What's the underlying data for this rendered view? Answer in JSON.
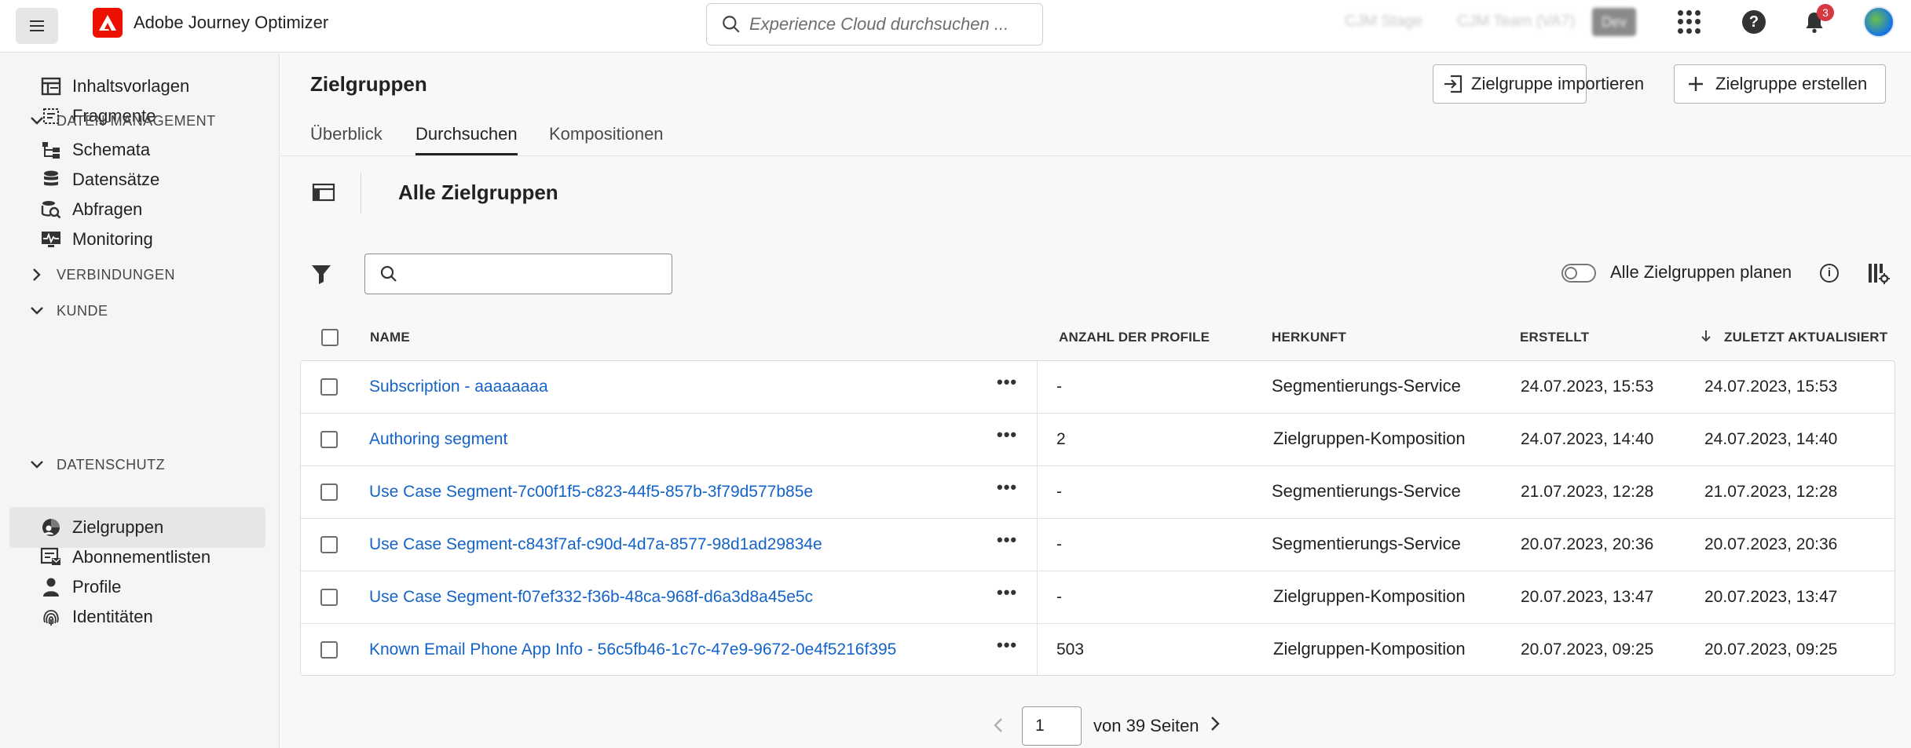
{
  "app": {
    "name": "Adobe Journey Optimizer",
    "search_placeholder": "Experience Cloud durchsuchen ...",
    "org_label": "CJM Stage",
    "team_label": "CJM Team (VA7)",
    "env_badge": "Dev",
    "notification_count": "3"
  },
  "sidebar": {
    "items_top": [
      {
        "label": "Inhaltsvorlagen",
        "icon": "template-icon"
      },
      {
        "label": "Fragmente",
        "icon": "fragment-icon"
      }
    ],
    "section_data": "DATEN-MANAGEMENT",
    "items_data": [
      {
        "label": "Schemata",
        "icon": "schema-icon"
      },
      {
        "label": "Datensätze",
        "icon": "database-icon"
      },
      {
        "label": "Abfragen",
        "icon": "query-icon"
      },
      {
        "label": "Monitoring",
        "icon": "monitoring-icon"
      }
    ],
    "section_connections": "VERBINDUNGEN",
    "section_customer": "KUNDE",
    "items_customer": [
      {
        "label": "Zielgruppen",
        "icon": "audience-icon"
      },
      {
        "label": "Abonnementlisten",
        "icon": "subscription-list-icon"
      },
      {
        "label": "Profile",
        "icon": "profile-icon"
      },
      {
        "label": "Identitäten",
        "icon": "fingerprint-icon"
      }
    ],
    "section_privacy": "DATENSCHUTZ"
  },
  "page": {
    "title": "Zielgruppen",
    "import_button": "Zielgruppe importieren",
    "create_button": "Zielgruppe erstellen",
    "tabs": [
      "Überblick",
      "Durchsuchen",
      "Kompositionen"
    ],
    "active_tab": "Durchsuchen",
    "section_title": "Alle Zielgruppen",
    "search_value": "",
    "toggle_label": "Alle Zielgruppen planen",
    "toggle_on": false
  },
  "table": {
    "headers": {
      "name": "NAME",
      "profiles": "ANZAHL DER PROFILE",
      "origin": "HERKUNFT",
      "created": "ERSTELLT",
      "updated": "ZULETZT AKTUALISIERT"
    },
    "sort_column": "updated",
    "sort_direction": "desc",
    "rows": [
      {
        "name": "Subscription - aaaaaaaa",
        "profiles": "-",
        "origin": "Segmentierungs-Service",
        "created": "24.07.2023, 15:53",
        "updated": "24.07.2023, 15:53"
      },
      {
        "name": "Authoring segment",
        "profiles": "2",
        "origin": "Zielgruppen-Komposition",
        "created": "24.07.2023, 14:40",
        "updated": "24.07.2023, 14:40"
      },
      {
        "name": "Use Case Segment-7c00f1f5-c823-44f5-857b-3f79d577b85e",
        "profiles": "-",
        "origin": "Segmentierungs-Service",
        "created": "21.07.2023, 12:28",
        "updated": "21.07.2023, 12:28"
      },
      {
        "name": "Use Case Segment-c843f7af-c90d-4d7a-8577-98d1ad29834e",
        "profiles": "-",
        "origin": "Segmentierungs-Service",
        "created": "20.07.2023, 20:36",
        "updated": "20.07.2023, 20:36"
      },
      {
        "name": "Use Case Segment-f07ef332-f36b-48ca-968f-d6a3d8a45e5c",
        "profiles": "-",
        "origin": "Zielgruppen-Komposition",
        "created": "20.07.2023, 13:47",
        "updated": "20.07.2023, 13:47"
      },
      {
        "name": "Known Email Phone App Info - 56c5fb46-1c7c-47e9-9672-0e4f5216f395",
        "profiles": "503",
        "origin": "Zielgruppen-Komposition",
        "created": "20.07.2023, 09:25",
        "updated": "20.07.2023, 09:25"
      }
    ]
  },
  "pagination": {
    "current_page": "1",
    "label": "von 39 Seiten"
  },
  "colors": {
    "brand": "#eb1000",
    "link": "#1463c8",
    "badge": "#d7373f"
  }
}
